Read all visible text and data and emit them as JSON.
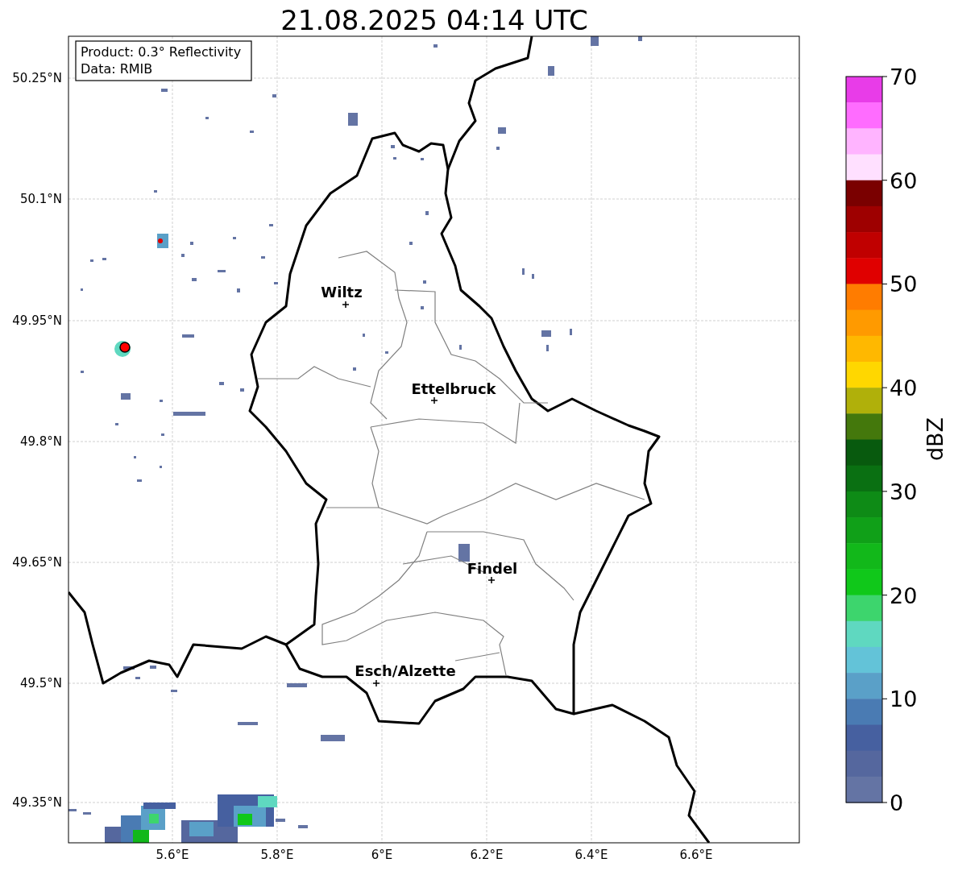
{
  "title": "21.08.2025 04:14 UTC",
  "info_box": {
    "lines": [
      "Product: 0.3° Reflectivity",
      "Data: RMIB"
    ]
  },
  "map": {
    "lat_ticks": [
      "50.25°N",
      "50.1°N",
      "49.95°N",
      "49.8°N",
      "49.65°N",
      "49.5°N",
      "49.35°N"
    ],
    "lon_ticks": [
      "5.6°E",
      "5.8°E",
      "6°E",
      "6.2°E",
      "6.4°E",
      "6.6°E"
    ],
    "cities": [
      {
        "name": "Wiltz"
      },
      {
        "name": "Ettelbruck"
      },
      {
        "name": "Findel"
      },
      {
        "name": "Esch/Alzette"
      }
    ]
  },
  "colorbar": {
    "label": "dBZ",
    "ticks": [
      "70",
      "60",
      "50",
      "40",
      "30",
      "20",
      "10",
      "0"
    ],
    "segments": [
      {
        "color": "#e83ce8"
      },
      {
        "color": "#ff6cff"
      },
      {
        "color": "#ffb4ff"
      },
      {
        "color": "#ffe0ff"
      },
      {
        "color": "#7a0000"
      },
      {
        "color": "#9e0000"
      },
      {
        "color": "#c00000"
      },
      {
        "color": "#e00000"
      },
      {
        "color": "#ff7c00"
      },
      {
        "color": "#ff9a00"
      },
      {
        "color": "#ffb800"
      },
      {
        "color": "#ffd700"
      },
      {
        "color": "#b0b00a"
      },
      {
        "color": "#44780c"
      },
      {
        "color": "#085a0e"
      },
      {
        "color": "#0a7012"
      },
      {
        "color": "#0e8b16"
      },
      {
        "color": "#10a018"
      },
      {
        "color": "#12b81a"
      },
      {
        "color": "#10c81a"
      },
      {
        "color": "#3dd56d"
      },
      {
        "color": "#5fd8c0"
      },
      {
        "color": "#63c3d8"
      },
      {
        "color": "#5aa0c8"
      },
      {
        "color": "#4a7bb3"
      },
      {
        "color": "#4660a0"
      },
      {
        "color": "#55679e"
      },
      {
        "color": "#6474a4"
      }
    ]
  }
}
